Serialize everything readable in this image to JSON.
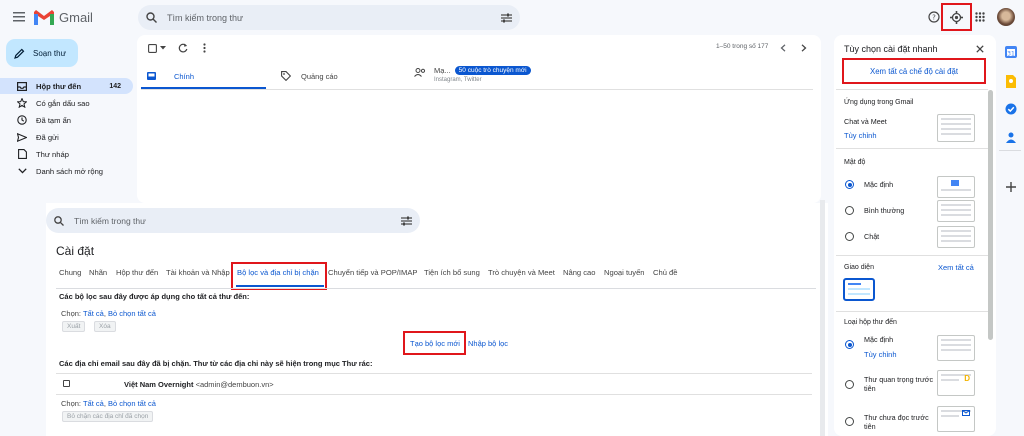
{
  "header": {
    "app_name": "Gmail",
    "search_placeholder": "Tìm kiếm trong thư"
  },
  "sidebar": {
    "compose_label": "Soạn thư",
    "items": [
      {
        "label": "Hộp thư đến",
        "count": "142"
      },
      {
        "label": "Có gắn dấu sao"
      },
      {
        "label": "Đã tạm ẩn"
      },
      {
        "label": "Đã gửi"
      },
      {
        "label": "Thư nháp"
      },
      {
        "label": "Danh sách mở rộng"
      }
    ]
  },
  "mail": {
    "pager_text": "1–50 trong số 177",
    "tabs": [
      {
        "label": "Chính"
      },
      {
        "label": "Quảng cáo"
      },
      {
        "label": "Mạ...",
        "badge": "50 cuộc trò chuyện mới",
        "sub": "Instagram, Twitter"
      }
    ]
  },
  "settings": {
    "search_placeholder": "Tìm kiếm trong thư",
    "title": "Cài đặt",
    "tabs": [
      "Chung",
      "Nhãn",
      "Hộp thư đến",
      "Tài khoản và Nhập",
      "Bộ lọc và địa chỉ bị chặn",
      "Chuyển tiếp và POP/IMAP",
      "Tiện ích bổ sung",
      "Trò chuyện và Meet",
      "Nâng cao",
      "Ngoại tuyến",
      "Chủ đề"
    ],
    "filters_heading": "Các bộ lọc sau đây được áp dụng cho tất cả thư đến:",
    "select_prefix": "Chọn: ",
    "select_all": "Tất cả",
    "select_sep": ", ",
    "select_none": "Bỏ chọn tất cả",
    "export_btn": "Xuất",
    "delete_btn": "Xóa",
    "create_filter": "Tạo bộ lọc mới",
    "import_filter": "Nhập bộ lọc",
    "blocked_heading": "Các địa chỉ email sau đây đã bị chặn. Thư từ các địa chỉ này sẽ hiện trong mục Thư rác:",
    "blocked_name": "Việt Nam Overnight",
    "blocked_email": "<admin@dembuon.vn>",
    "unblock_btn": "Bỏ chặn các địa chỉ đã chọn"
  },
  "quick_settings": {
    "title": "Tùy chọn cài đặt nhanh",
    "see_all": "Xem tất cả chế độ cài đặt",
    "apps_heading": "Ứng dụng trong Gmail",
    "chat_meet": "Chat và Meet",
    "customize": "Tùy chỉnh",
    "density_heading": "Mật độ",
    "density": [
      "Mặc định",
      "Bình thường",
      "Chật"
    ],
    "theme_heading": "Giao diện",
    "theme_see_all": "Xem tất cả",
    "inbox_heading": "Loại hộp thư đến",
    "inbox_default": "Mặc định",
    "inbox_customize": "Tùy chỉnh",
    "inbox_important": "Thư quan trọng trước tiên",
    "inbox_unread": "Thư chưa đọc trước tiên"
  },
  "colors": {
    "accent": "#0b57d0",
    "highlight": "#e0161b",
    "compose": "#c2e7ff"
  }
}
